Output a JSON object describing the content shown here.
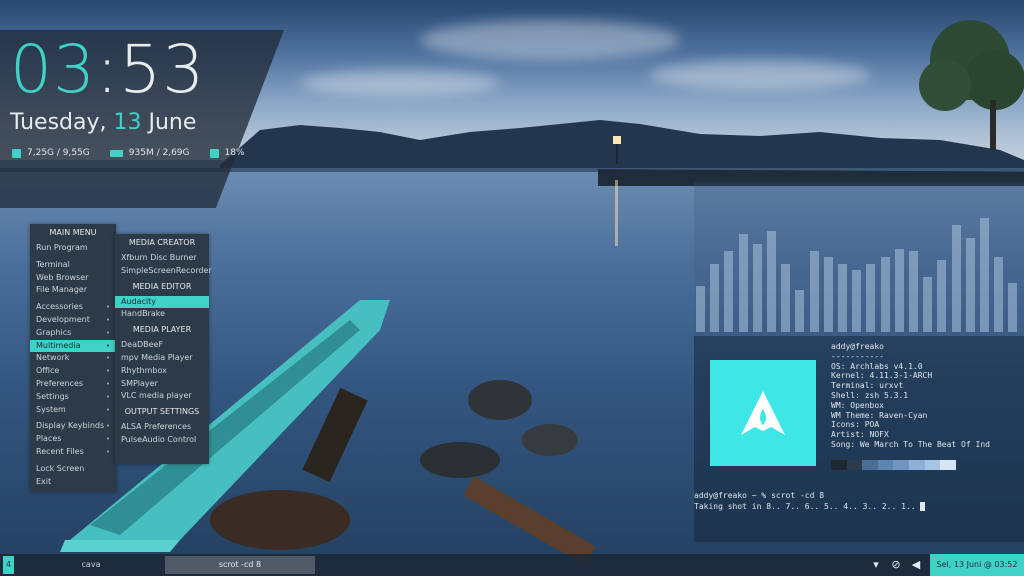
{
  "clock": {
    "hour": "03",
    "sep": ":",
    "minute": "53",
    "weekday": "Tuesday,",
    "day": "13",
    "month": "June"
  },
  "stats": {
    "disk": "7,25G / 9,55G",
    "memory": "935M / 2,69G",
    "cpu": "18%"
  },
  "main_menu": {
    "title": "MAIN MENU",
    "groups": [
      [
        "Run Program"
      ],
      [
        "Terminal",
        "Web Browser",
        "File Manager"
      ],
      [
        "Accessories",
        "Development",
        "Graphics",
        "Multimedia",
        "Network",
        "Office",
        "Preferences",
        "Settings",
        "System"
      ],
      [
        "Display Keybinds",
        "Places",
        "Recent Files"
      ],
      [
        "Lock Screen",
        "Exit"
      ]
    ],
    "selected": "Multimedia",
    "submenu_items": [
      "Accessories",
      "Development",
      "Graphics",
      "Multimedia",
      "Network",
      "Office",
      "Preferences",
      "Settings",
      "System",
      "Display Keybinds",
      "Places",
      "Recent Files"
    ]
  },
  "sub_menu": {
    "sections": [
      {
        "title": "MEDIA CREATOR",
        "items": [
          "Xfburn Disc Burner",
          "SimpleScreenRecorder"
        ]
      },
      {
        "title": "MEDIA EDITOR",
        "items": [
          "Audacity",
          "HandBrake"
        ]
      },
      {
        "title": "MEDIA PLAYER",
        "items": [
          "DeaDBeeF",
          "mpv Media Player",
          "Rhythmbox",
          "SMPlayer",
          "VLC media player"
        ]
      },
      {
        "title": "OUTPUT SETTINGS",
        "items": [
          "ALSA Preferences",
          "PulseAudio Control"
        ]
      }
    ],
    "selected": "Audacity"
  },
  "visualizer": {
    "levels": [
      0.35,
      0.52,
      0.62,
      0.75,
      0.68,
      0.78,
      0.52,
      0.32,
      0.62,
      0.58,
      0.52,
      0.48,
      0.52,
      0.58,
      0.64,
      0.62,
      0.42,
      0.55,
      0.82,
      0.72,
      0.88,
      0.58,
      0.38
    ]
  },
  "terminal": {
    "user_host": "addy@freako",
    "divider": "-----------",
    "info": [
      {
        "k": "OS:",
        "v": " Archlabs v4.1.0"
      },
      {
        "k": "Kernel:",
        "v": " 4.11.3-1-ARCH"
      },
      {
        "k": "Terminal:",
        "v": " urxvt"
      },
      {
        "k": "Shell:",
        "v": " zsh 5.3.1"
      },
      {
        "k": "WM:",
        "v": " Openbox"
      },
      {
        "k": "WM Theme:",
        "v": " Raven-Cyan"
      },
      {
        "k": "Icons:",
        "v": " POA"
      },
      {
        "k": "Artist:",
        "v": " NOFX"
      },
      {
        "k": "Song:",
        "v": " We March To The Beat Of Ind"
      }
    ],
    "swatches": [
      "#1e2832",
      "#2b3b4c",
      "#4a6f96",
      "#5b86b3",
      "#6f95c0",
      "#8fb0d6",
      "#a7c3e6",
      "#d7e6f5"
    ],
    "prompt_user": "addy@freako",
    "prompt_cmd": " ~ % scrot -cd 8",
    "output": "Taking shot in 8.. 7.. 6.. 5.. 4.. 3.. 2.. 1.. "
  },
  "taskbar": {
    "workspace": "4",
    "tasks": [
      "cava",
      "scrot -cd 8"
    ],
    "clock": "Sel, 13 Juni @ 03:52",
    "tray_icons": [
      "network-icon",
      "paperclip-icon",
      "volume-icon",
      "power-icon"
    ]
  },
  "colors": {
    "accent": "#3fd3c8",
    "logo": "#3fe6e6"
  }
}
